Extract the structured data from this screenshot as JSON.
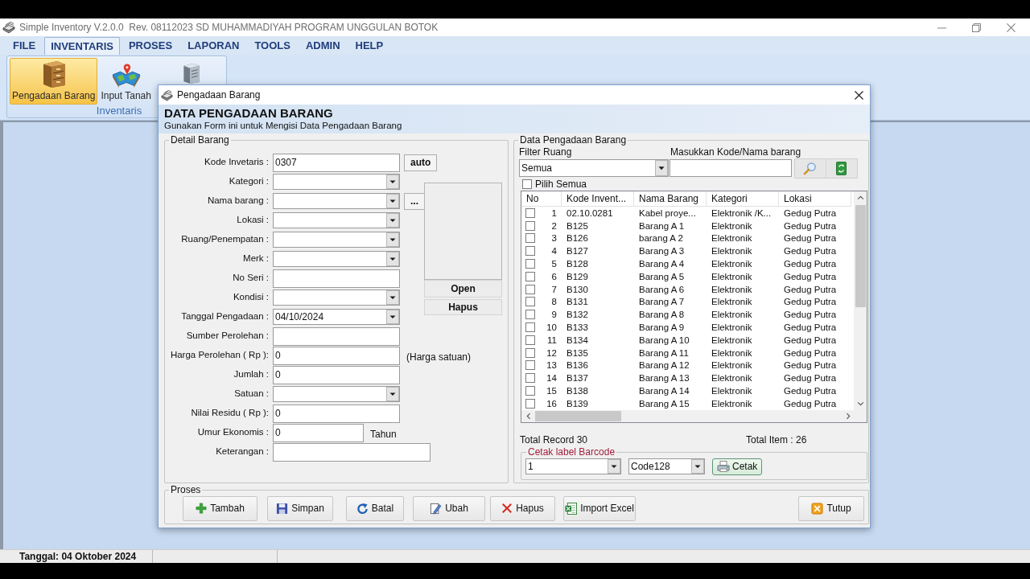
{
  "app": {
    "title": "Simple Inventory V.2.0.0  Rev. 08112023 SD MUHAMMADIYAH PROGRAM UNGGULAN BOTOK"
  },
  "menu": [
    {
      "label": "FILE",
      "selected": false
    },
    {
      "label": "INVENTARIS",
      "selected": true
    },
    {
      "label": "PROSES",
      "selected": false
    },
    {
      "label": "LAPORAN",
      "selected": false
    },
    {
      "label": "TOOLS",
      "selected": false
    },
    {
      "label": "ADMIN",
      "selected": false
    },
    {
      "label": "HELP",
      "selected": false
    }
  ],
  "ribbon": {
    "buttons": [
      {
        "label": "Pengadaan Barang",
        "selected": true
      },
      {
        "label": "Input Tanah",
        "selected": false
      }
    ],
    "group": "Inventaris"
  },
  "dialog": {
    "title": "Pengadaan Barang",
    "heading": "DATA PENGADAAN BARANG",
    "subheading": "Gunakan Form ini untuk Mengisi Data Pengadaan Barang",
    "detail": {
      "title": "Detail Barang",
      "fields": [
        {
          "label": "Kode Invetaris :",
          "kind": "text",
          "value": "0307",
          "button": "auto"
        },
        {
          "label": "Kategori :",
          "kind": "combo"
        },
        {
          "label": "Nama barang :",
          "kind": "combo",
          "button": "..."
        },
        {
          "label": "Lokasi :",
          "kind": "combo"
        },
        {
          "label": "Ruang/Penempatan :",
          "kind": "combo"
        },
        {
          "label": "Merk :",
          "kind": "combo"
        },
        {
          "label": "No Seri :",
          "kind": "text"
        },
        {
          "label": "Kondisi :",
          "kind": "combo"
        },
        {
          "label": "Tanggal Pengadaan :",
          "kind": "combo",
          "value": "04/10/2024"
        },
        {
          "label": "Sumber Perolehan :",
          "kind": "text"
        },
        {
          "label": "Harga Perolehan ( Rp ):",
          "kind": "text",
          "value": "0",
          "suffix": "(Harga satuan)"
        },
        {
          "label": "Jumlah :",
          "kind": "text",
          "value": "0"
        },
        {
          "label": "Satuan :",
          "kind": "combo"
        },
        {
          "label": "Nilai Residu ( Rp ):",
          "kind": "text",
          "value": "0"
        },
        {
          "label": "Umur Ekonomis :",
          "kind": "short",
          "value": "0",
          "suffix": "Tahun"
        },
        {
          "label": "Keterangan :",
          "kind": "wide"
        }
      ],
      "image_buttons": [
        "Open",
        "Hapus"
      ]
    },
    "list": {
      "title": "Data Pengadaan Barang",
      "filter_label": "Filter Ruang",
      "filter_value": "Semua",
      "search_label": "Masukkan Kode/Nama barang",
      "select_all": {
        "label": "Pilih Semua",
        "checked": false
      },
      "columns": [
        "No",
        "Kode Invent...",
        "Nama Barang",
        "Kategori",
        "Lokasi"
      ],
      "rows": [
        {
          "checked": false,
          "cells": [
            "1",
            "02.10.0281",
            "Kabel proye...",
            "Elektronik /K...",
            "Gedug Putra"
          ]
        },
        {
          "checked": false,
          "cells": [
            "2",
            "B125",
            "Barang A 1",
            "Elektronik",
            "Gedug Putra"
          ]
        },
        {
          "checked": false,
          "cells": [
            "3",
            "B126",
            "barang A 2",
            "Elektronik",
            "Gedug Putra"
          ]
        },
        {
          "checked": false,
          "cells": [
            "4",
            "B127",
            "Barang A 3",
            "Elektronik",
            "Gedug Putra"
          ]
        },
        {
          "checked": false,
          "cells": [
            "5",
            "B128",
            "Barang A 4",
            "Elektronik",
            "Gedug Putra"
          ]
        },
        {
          "checked": false,
          "cells": [
            "6",
            "B129",
            "Barang A 5",
            "Elektronik",
            "Gedug Putra"
          ]
        },
        {
          "checked": false,
          "cells": [
            "7",
            "B130",
            "Barang A 6",
            "Elektronik",
            "Gedug Putra"
          ]
        },
        {
          "checked": false,
          "cells": [
            "8",
            "B131",
            "Barang A 7",
            "Elektronik",
            "Gedug Putra"
          ]
        },
        {
          "checked": false,
          "cells": [
            "9",
            "B132",
            "Barang A 8",
            "Elektronik",
            "Gedug Putra"
          ]
        },
        {
          "checked": false,
          "cells": [
            "10",
            "B133",
            "Barang A 9",
            "Elektronik",
            "Gedug Putra"
          ]
        },
        {
          "checked": false,
          "cells": [
            "11",
            "B134",
            "Barang A 10",
            "Elektronik",
            "Gedug Putra"
          ]
        },
        {
          "checked": false,
          "cells": [
            "12",
            "B135",
            "Barang A 11",
            "Elektronik",
            "Gedug Putra"
          ]
        },
        {
          "checked": false,
          "cells": [
            "13",
            "B136",
            "Barang A 12",
            "Elektronik",
            "Gedug Putra"
          ]
        },
        {
          "checked": false,
          "cells": [
            "14",
            "B137",
            "Barang A 13",
            "Elektronik",
            "Gedug Putra"
          ]
        },
        {
          "checked": false,
          "cells": [
            "15",
            "B138",
            "Barang A 14",
            "Elektronik",
            "Gedug Putra"
          ]
        },
        {
          "checked": false,
          "cells": [
            "16",
            "B139",
            "Barang A 15",
            "Elektronik",
            "Gedug Putra"
          ]
        }
      ],
      "total_record": "Total Record 30",
      "total_item": "Total Item : 26",
      "barcode": {
        "title": "Cetak label Barcode",
        "copies": "1",
        "format": "Code128",
        "print_button": "Cetak"
      }
    },
    "actions": {
      "title": "Proses",
      "buttons": [
        "Tambah",
        "Simpan",
        "Batal",
        "Ubah",
        "Hapus",
        "Import Excel",
        "Tutup"
      ]
    }
  },
  "status_bar": {
    "date": "Tanggal: 04 Oktober 2024"
  }
}
